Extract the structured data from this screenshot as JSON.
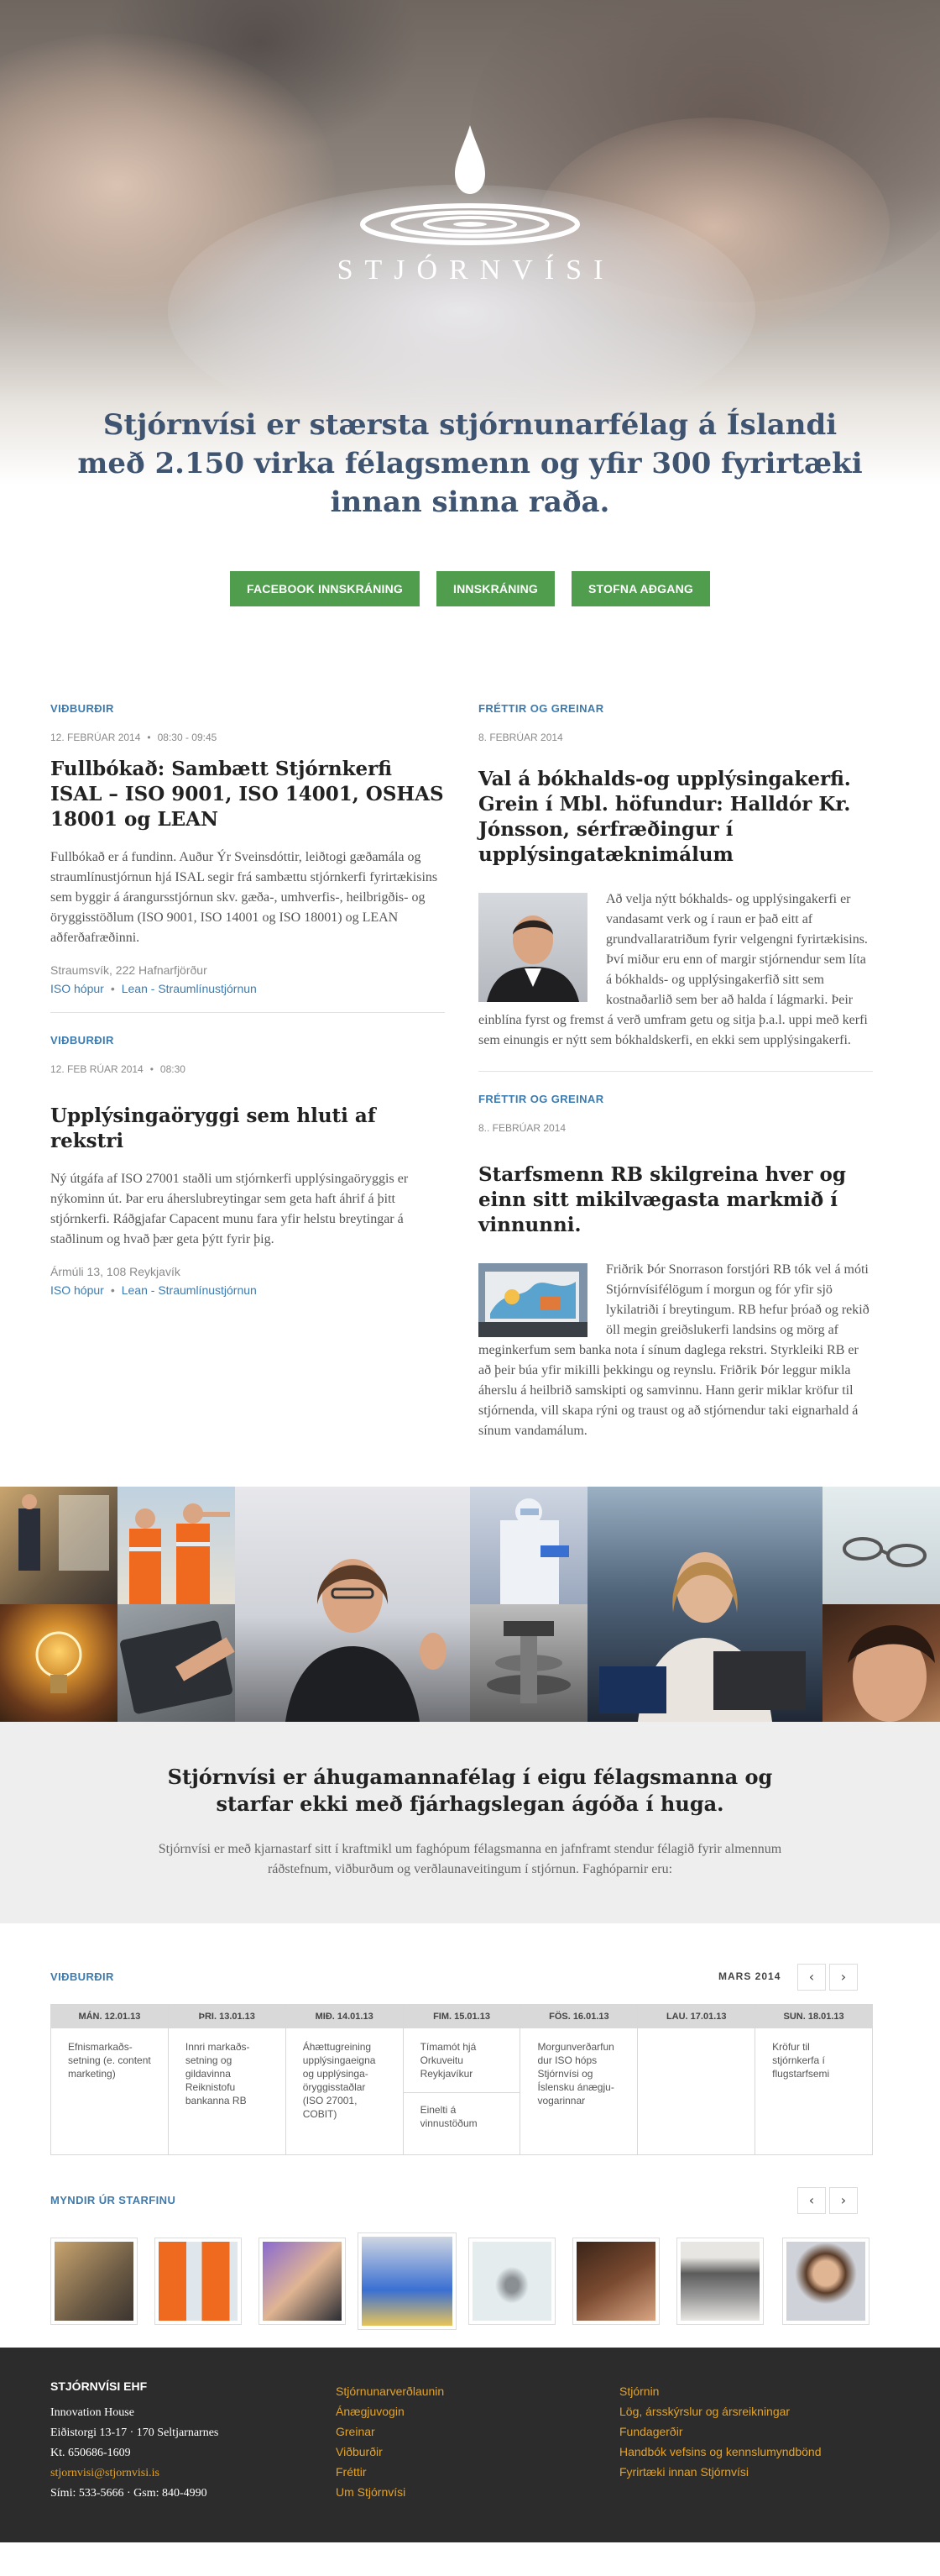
{
  "brand": {
    "name": "STJÓRNVÍSI"
  },
  "hero": {
    "title": "Stjórnvísi er stærsta stjórnunarfélag á Íslandi með 2.150 virka félagsmenn og yfir 300 fyrirtæki innan sinna raða.",
    "buttons": [
      {
        "label": "FACEBOOK INNSKRÁNING"
      },
      {
        "label": "INNSKRÁNING"
      },
      {
        "label": "STOFNA AÐGANG"
      }
    ]
  },
  "events": [
    {
      "section": "VIÐBURÐIR",
      "date": "12. FEBRÚAR 2014",
      "time": "08:30 - 09:45",
      "title": "Fullbókað: Sambætt Stjórnkerfi ISAL – ISO 9001, ISO 14001, OSHAS 18001 og LEAN",
      "text": "Fullbókað er á fundinn. Auður Ýr Sveinsdóttir, leiðtogi gæðamála og straumlínustjórnun hjá ISAL segir frá sambættu stjórnkerfi fyrirtækisins sem byggir á árangursstjórnun skv. gæða-, umhverfis-, heilbrigðis- og öryggisstöðlum (ISO 9001, ISO 14001 og ISO 18001) og LEAN aðferðafræðinni.",
      "address": "Straumsvík, 222 Hafnarfjörður",
      "tags": [
        "ISO hópur",
        "Lean - Straumlínustjórnun"
      ]
    },
    {
      "section": "VIÐBURÐIR",
      "date": "12. FEB RÚAR 2014",
      "time": "08:30",
      "title": "Upplýsingaöryggi sem hluti af rekstri",
      "text": "Ný útgáfa af ISO 27001 staðli um stjórnkerfi upplýsingaöryggis er nýkominn út. Þar eru áherslubreytingar sem geta haft áhrif á þitt stjórnkerfi. Ráðgjafar Capacent munu fara yfir helstu breytingar á staðlinum og hvað þær geta þýtt fyrir þig.",
      "address": "Ármúli 13, 108 Reykjavík",
      "tags": [
        "ISO hópur",
        "Lean - Straumlínustjórnun"
      ]
    }
  ],
  "news": [
    {
      "section": "FRÉTTIR OG GREINAR",
      "date": "8. FEBRÚAR 2014",
      "title": "Val á bókhalds-og upplýsingakerfi. Grein í Mbl. höfundur: Halldór Kr. Jónsson, sérfræðingur í upplýsingatæknimálum",
      "text": "Að velja nýtt bókhalds- og upplýsingakerfi er vandasamt verk og í raun er það eitt af grundvallaratriðum fyrir velgengni fyrirtækisins. Því miður eru enn of margir stjórnendur sem líta á bókhalds- og upplýsingakerfið sitt sem kostnaðarlið sem ber að halda í lágmarki. Þeir einblína fyrst og fremst á verð umfram getu og sitja þ.a.l. uppi með kerfi sem einungis er nýtt sem bókhaldskerfi, en ekki sem upplýsingakerfi."
    },
    {
      "section": "FRÉTTIR OG GREINAR",
      "date": "8.. FEBRÚAR 2014",
      "title": "Starfsmenn RB skilgreina hver og einn sitt mikilvægasta markmið í vinnunni.",
      "text": "Friðrik Þór Snorrason forstjóri RB tók vel á móti Stjórnvísifélögum í morgun og fór yfir sjö lykilatriði í breytingum. RB hefur þróað og rekið öll megin greiðslukerfi landsins og mörg af meginkerfum sem banka nota í sínum daglega rekstri. Styrkleiki RB er að þeir búa yfir mikilli þekkingu og reynslu. Friðrik Þór leggur mikla áherslu á heilbrið samskipti og samvinnu. Hann gerir miklar kröfur til stjórnenda, vill skapa rýni og traust og að stjórnendur taki eignarhald á sínum vandamálum."
    }
  ],
  "about": {
    "title": "Stjórnvísi er áhugamannafélag í eigu félagsmanna og starfar ekki með fjárhagslegan ágóða í huga.",
    "text": "Stjórnvísi er með kjarnastarf sitt í kraftmikl um faghópum félagsmanna en jafnframt stendur félagið fyrir almennum ráðstefnum, viðburðum og verðlaunaveitingum í stjórnun. Faghóparnir eru:"
  },
  "calendar": {
    "section": "VIÐBURÐIR",
    "month": "MARS 2014",
    "prev": "‹",
    "next": "›",
    "days": [
      {
        "label": "MÁN. 12.01.13",
        "events": [
          "Efnismarkaðs-setning (e. content marketing)"
        ]
      },
      {
        "label": "ÞRI. 13.01.13",
        "events": [
          "Innri markaðs-setning og gildavinna Reiknistofu bankanna RB"
        ]
      },
      {
        "label": "MIÐ. 14.01.13",
        "events": [
          "Áhættugreining upplýsingaeigna og upplýsinga-öryggisstaðlar (ISO 27001, COBIT)"
        ]
      },
      {
        "label": "FIM. 15.01.13",
        "events": [
          "Tímamót hjá Orkuveitu Reykjavíkur",
          "Einelti á vinnustöðum"
        ]
      },
      {
        "label": "FÖS. 16.01.13",
        "events": [
          "Morgunverðarfun dur ISO hóps Stjórnvísi og Íslensku ánægju-vogarinnar"
        ]
      },
      {
        "label": "LAU. 17.01.13",
        "events": []
      },
      {
        "label": "SUN. 18.01.13",
        "events": [
          "Kröfur til stjórnkerfa í flugstarfsemi"
        ]
      }
    ]
  },
  "gallery": {
    "section": "MYNDIR ÚR STARFINU",
    "prev": "‹",
    "next": "›"
  },
  "footer": {
    "company": {
      "title": "STJÓRNVÍSI EHF",
      "lines": [
        "Innovation House",
        "Eiðistorgi 13-17 · 170 Seltjarnarnes",
        "Kt. 650686-1609"
      ],
      "email": "stjornvisi@stjornvisi.is",
      "phone": "Sími: 533-5666 · Gsm: 840-4990"
    },
    "col2": [
      "Stjórnunarverðlaunin",
      "Ánægjuvogin",
      "Greinar",
      "Viðburðir",
      "Fréttir",
      "Um Stjórnvísi"
    ],
    "col3": [
      "Stjórnin",
      "Lög, ársskýrslur og ársreikningar",
      "Fundagerðir",
      "Handbók vefsins og kennslumyndbönd",
      "Fyrirtæki innan Stjórnvísi"
    ]
  },
  "colors": {
    "accent_blue": "#3c7bb0",
    "hero_title": "#3f5470",
    "button_green": "#4f9d4d",
    "footer_bg": "#2c2c2c",
    "footer_link": "#e8a21f"
  }
}
